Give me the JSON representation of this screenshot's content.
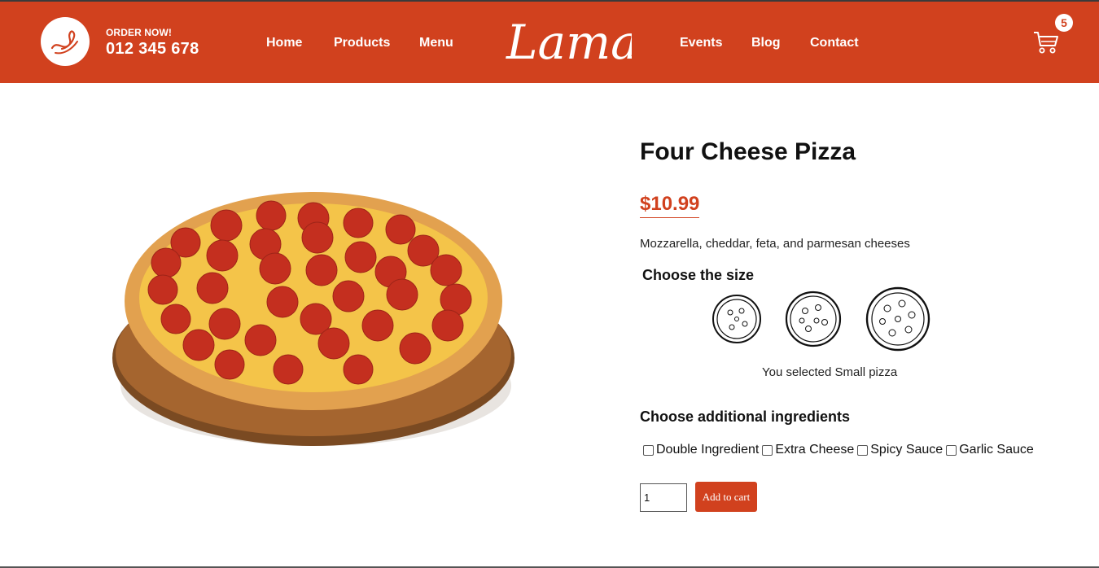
{
  "navbar": {
    "order_label": "ORDER NOW!",
    "phone": "012 345 678",
    "links_left": [
      "Home",
      "Products",
      "Menu"
    ],
    "logo_text": "Lama",
    "links_right": [
      "Events",
      "Blog",
      "Contact"
    ],
    "cart_count": "5",
    "icons": {
      "phone": "phone-icon",
      "cart": "cart-icon"
    }
  },
  "product": {
    "title": "Four Cheese Pizza",
    "price": "$10.99",
    "description": "Mozzarella, cheddar, feta, and parmesan cheeses",
    "choose_size_label": "Choose the size",
    "size_options": [
      "Small",
      "Medium",
      "Large"
    ],
    "selected_size_text": "You selected Small pizza",
    "choose_ingredients_label": "Choose additional ingredients",
    "ingredients": [
      "Double Ingredient",
      "Extra Cheese",
      "Spicy Sauce",
      "Garlic Sauce"
    ],
    "quantity": "1",
    "add_to_cart_label": "Add to cart"
  },
  "colors": {
    "brand": "#d1411e",
    "text": "#111111",
    "background": "#ffffff"
  }
}
